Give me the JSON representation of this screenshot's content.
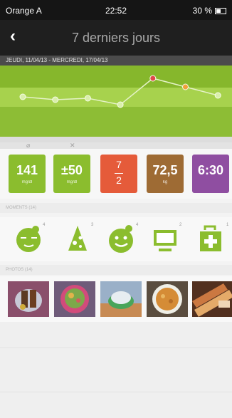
{
  "status": {
    "carrier": "Orange A",
    "time": "22:52",
    "battery": "30 %"
  },
  "nav": {
    "back": "‹",
    "title": "7 derniers jours"
  },
  "daterange": "JEUDI, 11/04/13 - MERCREDI, 17/04/13",
  "chart_data": {
    "type": "line",
    "points": [
      {
        "y": 0.44,
        "status": "normal"
      },
      {
        "y": 0.48,
        "status": "normal"
      },
      {
        "y": 0.46,
        "status": "normal"
      },
      {
        "y": 0.55,
        "status": "normal"
      },
      {
        "y": 0.18,
        "status": "high"
      },
      {
        "y": 0.3,
        "status": "warning"
      },
      {
        "y": 0.42,
        "status": "normal"
      }
    ],
    "colors": {
      "normal": "#d9efab",
      "high": "#e0474a",
      "warning": "#f0a03a"
    }
  },
  "metrics": [
    {
      "value": "141",
      "unit": "mg/dl",
      "color": "#8bbd2e"
    },
    {
      "value": "±50",
      "unit": "mg/dl",
      "color": "#8bbd2e"
    },
    {
      "numerator": "7",
      "denominator": "2",
      "color": "#e55b3a"
    },
    {
      "value": "72,5",
      "unit": "kg",
      "color": "#9e6b34"
    },
    {
      "value": "6:30",
      "unit": "",
      "color": "#8f4ea1"
    }
  ],
  "sections": {
    "moments": "MOMENTS (14)",
    "photos": "PHOTOS (14)"
  },
  "moments": [
    {
      "icon": "sleep-face-icon",
      "count": "4"
    },
    {
      "icon": "food-icon",
      "count": "3"
    },
    {
      "icon": "happy-face-icon",
      "count": "4"
    },
    {
      "icon": "computer-icon",
      "count": "2"
    },
    {
      "icon": "medical-kit-icon",
      "count": "1"
    }
  ],
  "photos": [
    "photo-skewers",
    "photo-salad",
    "photo-dessert",
    "photo-soup",
    "photo-bread"
  ]
}
